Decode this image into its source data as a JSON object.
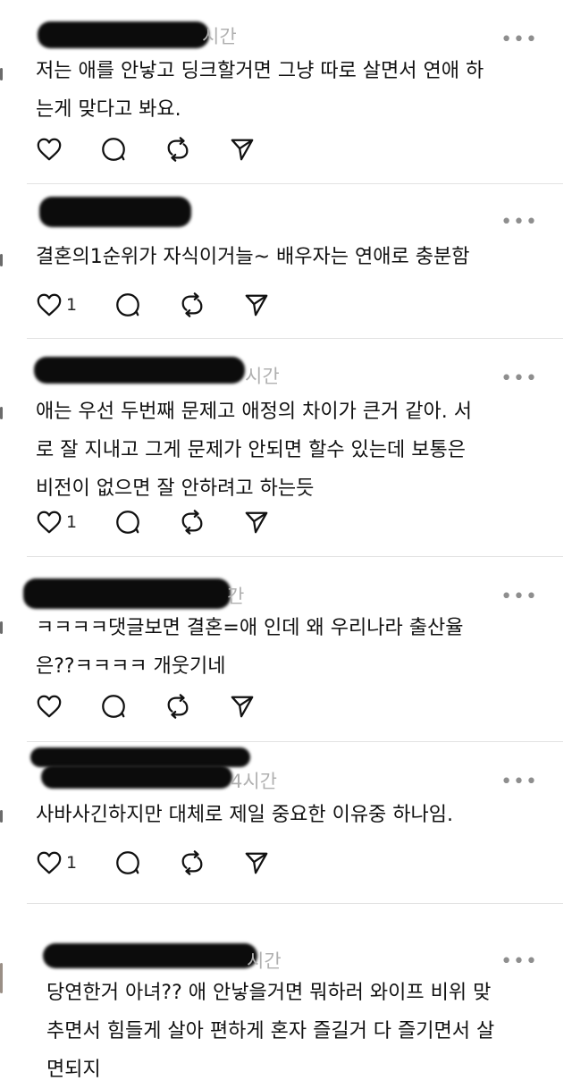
{
  "more_glyph": "•••",
  "posts": [
    {
      "time": "시간",
      "text": "저는 애를 안낳고 딩크할거면 그냥 따로 살면서 연애 하\n는게 맞다고 봐요.",
      "likes": ""
    },
    {
      "time": "",
      "text": "결혼의1순위가 자식이거늘~ 배우자는 연애로 충분함",
      "likes": "1"
    },
    {
      "time": "시간",
      "text": "애는 우선 두번째 문제고 애정의 차이가 큰거 같아. 서\n로 잘 지내고 그게 문제가 안되면 할수 있는데 보통은\n비전이 없으면 잘 안하려고 하는듯",
      "likes": "1"
    },
    {
      "time": "간",
      "text": "ㅋㅋㅋㅋ댓글보면 결혼=애 인데 왜 우리나라 출산율\n은??ㅋㅋㅋㅋ 개웃기네",
      "likes": ""
    },
    {
      "time": "4시간",
      "text": "사바사긴하지만 대체로 제일 중요한 이유중 하나임.",
      "likes": "1"
    },
    {
      "time": "시간",
      "text": "당연한거 아녀?? 애 안낳을거면 뭐하러 와이프 비위 맞\n추면서 힘들게 살아 편하게 혼자 즐길거 다 즐기면서 살\n면되지",
      "likes": ""
    }
  ],
  "icons": {
    "like": "heart-icon",
    "comment": "comment-bubble-icon",
    "repost": "repost-icon",
    "share": "send-icon",
    "more": "more-options-icon"
  }
}
